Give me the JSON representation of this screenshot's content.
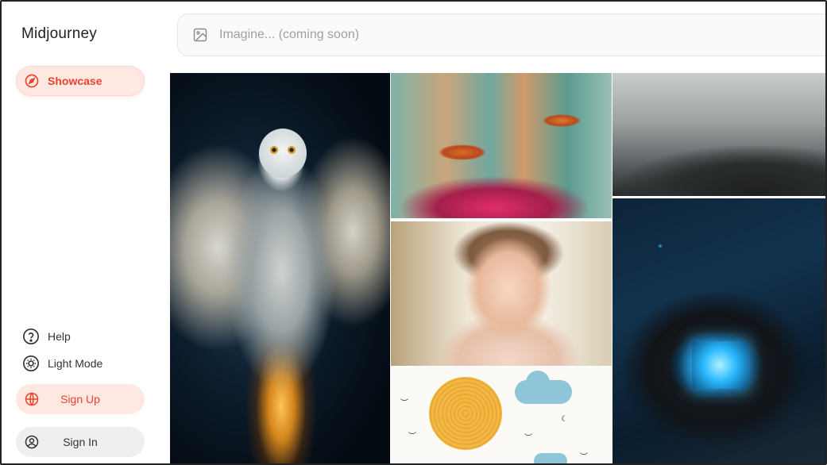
{
  "app": {
    "name": "Midjourney"
  },
  "sidebar": {
    "showcase_label": "Showcase",
    "help_label": "Help",
    "light_mode_label": "Light Mode",
    "sign_up_label": "Sign Up",
    "sign_in_label": "Sign In"
  },
  "search": {
    "placeholder": "Imagine... (coming soon)",
    "value": ""
  },
  "gallery": {
    "images": [
      {
        "subject": "snowy owl with glowing particles"
      },
      {
        "subject": "orange mushrooms and pink flowers"
      },
      {
        "subject": "hooded dark figures in fog"
      },
      {
        "subject": "toddler among daisies"
      },
      {
        "subject": "sun, cloud and birds illustration"
      },
      {
        "subject": "glowing circuit board chip"
      }
    ]
  },
  "colors": {
    "accent": "#e9432a",
    "accent_bg": "#ffe7e2",
    "neutral_btn_bg": "#efefef"
  },
  "icons": {
    "showcase": "compass-icon",
    "help": "help-icon",
    "light_mode": "sun-icon",
    "sign_up": "globe-icon",
    "sign_in": "user-circle-icon",
    "search": "image-icon"
  }
}
